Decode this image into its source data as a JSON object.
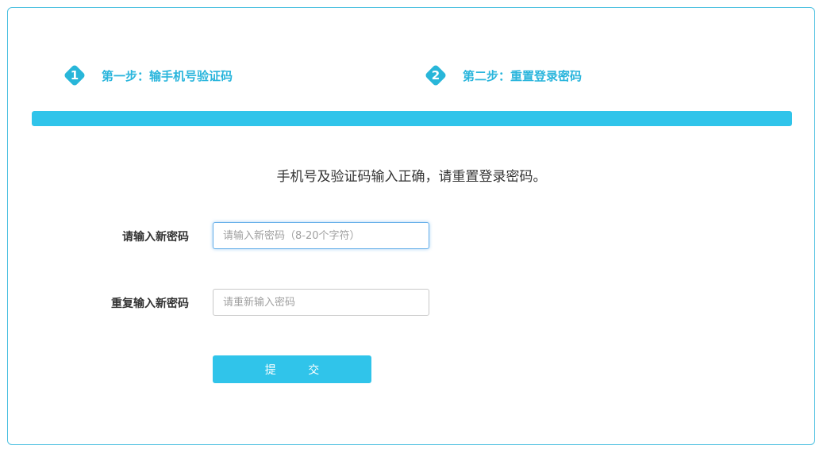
{
  "steps": [
    {
      "number": "1",
      "label": "第一步：输手机号验证码"
    },
    {
      "number": "2",
      "label": "第二步：重置登录密码"
    }
  ],
  "progress": {
    "value": 1.0
  },
  "notice": "手机号及验证码输入正确，请重置登录密码。",
  "form": {
    "new_password": {
      "label": "请输入新密码",
      "placeholder": "请输入新密码（8-20个字符）",
      "value": ""
    },
    "repeat_password": {
      "label": "重复输入新密码",
      "placeholder": "请重新输入密码",
      "value": ""
    },
    "submit_label": "提 交"
  },
  "colors": {
    "accent": "#30c4ea",
    "step_text": "#29b5dc",
    "border": "#4bc0e0"
  }
}
